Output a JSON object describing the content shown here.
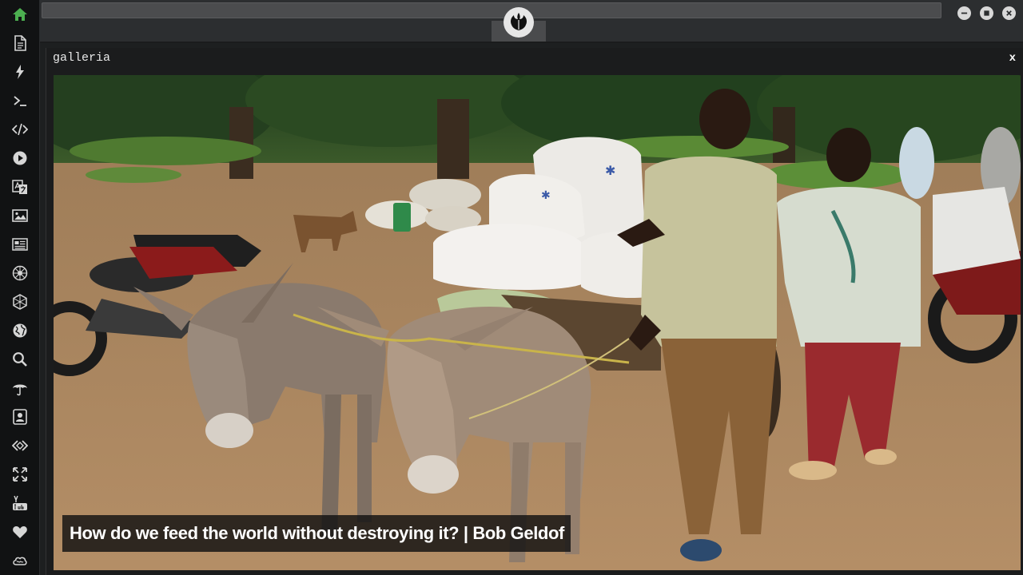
{
  "sidebar": {
    "items": [
      {
        "icon": "home-icon",
        "name": "sidebar-item-home",
        "active": true
      },
      {
        "icon": "document-icon",
        "name": "sidebar-item-documents"
      },
      {
        "icon": "lightning-icon",
        "name": "sidebar-item-power"
      },
      {
        "icon": "terminal-icon",
        "name": "sidebar-item-terminal"
      },
      {
        "icon": "code-icon",
        "name": "sidebar-item-code"
      },
      {
        "icon": "play-circle-icon",
        "name": "sidebar-item-media"
      },
      {
        "icon": "translate-icon",
        "name": "sidebar-item-translate"
      },
      {
        "icon": "image-icon",
        "name": "sidebar-item-gallery"
      },
      {
        "icon": "newspaper-icon",
        "name": "sidebar-item-news"
      },
      {
        "icon": "rebel-emblem-icon",
        "name": "sidebar-item-rebel"
      },
      {
        "icon": "empire-emblem-icon",
        "name": "sidebar-item-empire"
      },
      {
        "icon": "globe-icon",
        "name": "sidebar-item-globe"
      },
      {
        "icon": "search-icon",
        "name": "sidebar-item-search"
      },
      {
        "icon": "umbrella-icon",
        "name": "sidebar-item-weather"
      },
      {
        "icon": "contact-card-icon",
        "name": "sidebar-item-contacts"
      },
      {
        "icon": "dev-code-icon",
        "name": "sidebar-item-dev"
      },
      {
        "icon": "expand-icon",
        "name": "sidebar-item-fullscreen"
      },
      {
        "icon": "youtube-icon",
        "name": "sidebar-item-youtube"
      },
      {
        "icon": "heart-icon",
        "name": "sidebar-item-favorites"
      },
      {
        "icon": "cloud-icon",
        "name": "sidebar-item-cloud"
      }
    ]
  },
  "topbar": {
    "logo_icon": "rebel-alliance-icon",
    "controls": [
      "minimize-icon",
      "maximize-icon",
      "close-icon"
    ]
  },
  "gallery": {
    "title": "galleria",
    "close_label": "x",
    "caption": "How do we feed the world without destroying it? | Bob Geldof"
  },
  "colors": {
    "active_accent": "#4caf50",
    "sidebar_bg": "#111213",
    "topbar_bg": "#2c2e30"
  }
}
